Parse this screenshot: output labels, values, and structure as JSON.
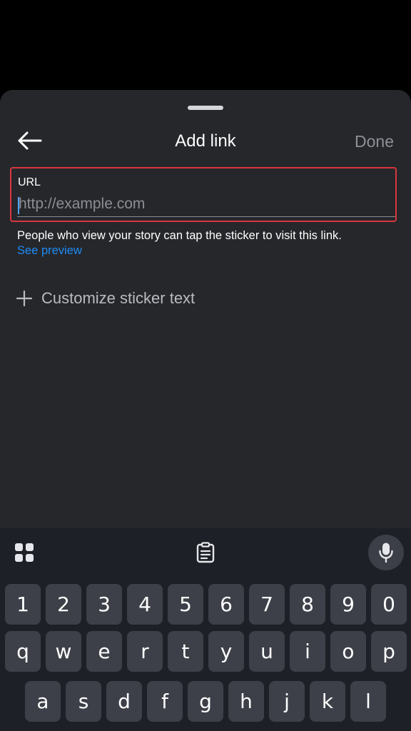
{
  "sheet": {
    "title": "Add link",
    "done_label": "Done"
  },
  "url_field": {
    "label": "URL",
    "placeholder": "http://example.com",
    "value": ""
  },
  "helper": {
    "text": "People who view your story can tap the sticker to visit this link.",
    "preview_link": "See preview"
  },
  "customize": {
    "label": "Customize sticker text"
  },
  "keyboard": {
    "row_numbers": [
      "1",
      "2",
      "3",
      "4",
      "5",
      "6",
      "7",
      "8",
      "9",
      "0"
    ],
    "row_top": [
      "q",
      "w",
      "e",
      "r",
      "t",
      "y",
      "u",
      "i",
      "o",
      "p"
    ],
    "row_middle": [
      "a",
      "s",
      "d",
      "f",
      "g",
      "h",
      "j",
      "k",
      "l"
    ],
    "tools": [
      "apps-grid-icon",
      "clipboard-icon",
      "microphone-icon"
    ]
  },
  "colors": {
    "sheet_background": "#26272b",
    "error_border": "#d9363e",
    "link_blue": "#1d8cf8",
    "keyboard_background": "#1e2027",
    "key_background": "#3d4048"
  }
}
